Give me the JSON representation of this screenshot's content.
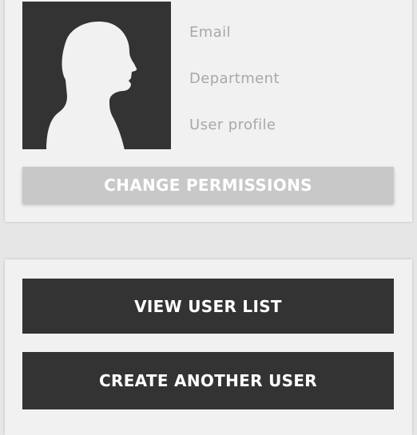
{
  "profile": {
    "avatar_icon": "user-silhouette-icon",
    "fields": {
      "email_label": "Email",
      "department_label": "Department",
      "user_profile_label": "User profile"
    },
    "change_permissions_label": "CHANGE PERMISSIONS"
  },
  "actions": {
    "view_user_list_label": "VIEW USER LIST",
    "create_another_user_label": "CREATE ANOTHER USER"
  },
  "colors": {
    "page_background": "#e6e6e6",
    "card_background": "#f1f1f1",
    "dark_button": "#333333",
    "disabled_button": "#c8c8c8",
    "label_text": "#a8a8a8"
  }
}
